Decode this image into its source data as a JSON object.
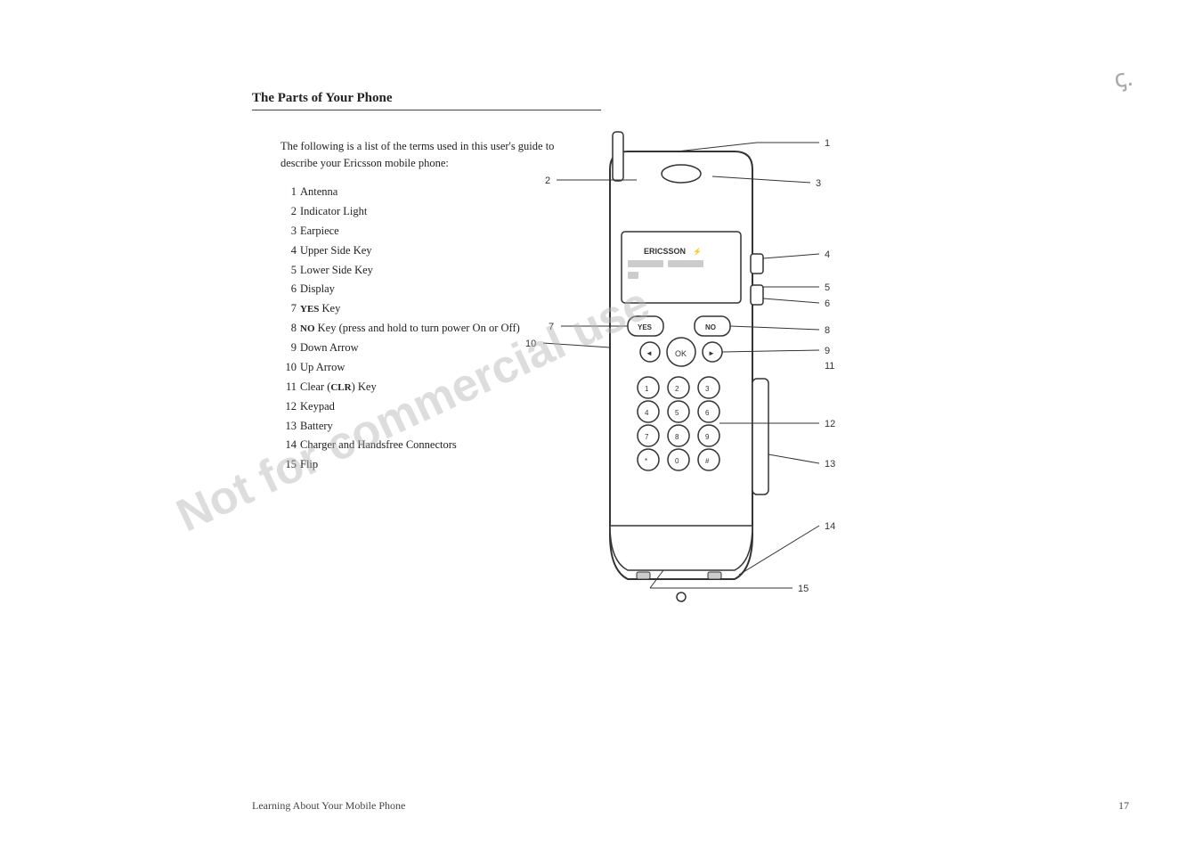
{
  "title": "The Parts of Your Phone",
  "intro": "The following is a list of the terms used in this user's guide to describe your Ericsson mobile phone:",
  "parts": [
    {
      "num": "1",
      "label": "Antenna"
    },
    {
      "num": "2",
      "label": "Indicator Light"
    },
    {
      "num": "3",
      "label": "Earpiece"
    },
    {
      "num": "4",
      "label": "Upper Side Key"
    },
    {
      "num": "5",
      "label": "Lower Side Key"
    },
    {
      "num": "6",
      "label": "Display"
    },
    {
      "num": "7",
      "label": "<b>YES</b> Key"
    },
    {
      "num": "8",
      "label": "<b>NO</b> Key (press and hold to turn power On or Off)"
    },
    {
      "num": "9",
      "label": "Down Arrow"
    },
    {
      "num": "10",
      "label": "Up Arrow"
    },
    {
      "num": "11",
      "label": "Clear (<b>CLR</b>) Key"
    },
    {
      "num": "12",
      "label": "Keypad"
    },
    {
      "num": "13",
      "label": "Battery"
    },
    {
      "num": "14",
      "label": "Charger and Handsfree Connectors"
    },
    {
      "num": "15",
      "label": "Flip"
    }
  ],
  "watermark": "Not for commercial use",
  "footer_left": "Learning About Your Mobile Phone",
  "footer_right": "17"
}
